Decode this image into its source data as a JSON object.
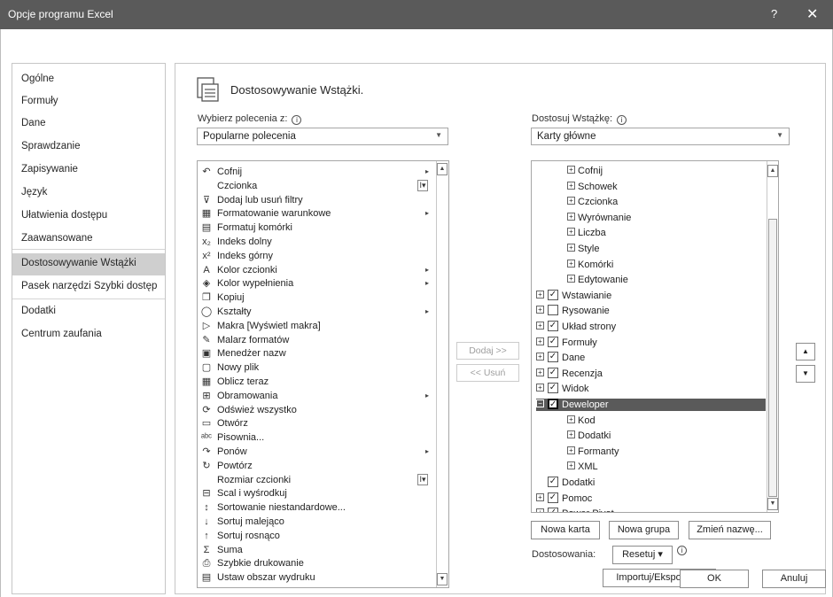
{
  "window": {
    "title": "Opcje programu Excel",
    "help": "?",
    "close": "✕"
  },
  "nav": [
    {
      "label": "Ogólne",
      "selected": false
    },
    {
      "label": "Formuły",
      "selected": false
    },
    {
      "label": "Dane",
      "selected": false
    },
    {
      "label": "Sprawdzanie",
      "selected": false
    },
    {
      "label": "Zapisywanie",
      "selected": false
    },
    {
      "label": "Język",
      "selected": false
    },
    {
      "label": "Ułatwienia dostępu",
      "selected": false
    },
    {
      "label": "Zaawansowane",
      "selected": false
    },
    {
      "label": "Dostosowywanie Wstążki",
      "selected": true
    },
    {
      "label": "Pasek narzędzi Szybki dostęp",
      "selected": false
    },
    {
      "label": "Dodatki",
      "selected": false
    },
    {
      "label": "Centrum zaufania",
      "selected": false
    }
  ],
  "header": {
    "title": "Dostosowywanie Wstążki."
  },
  "left": {
    "choose_label": "Wybierz polecenia z:",
    "choose_value": "Popularne polecenia",
    "commands": [
      {
        "icon": "↶",
        "label": "Cofnij",
        "sub": "▸"
      },
      {
        "icon": "",
        "label": "Czcionka",
        "subbox": "I▾"
      },
      {
        "icon": "⊽",
        "label": "Dodaj lub usuń filtry",
        "sub": ""
      },
      {
        "icon": "▦",
        "label": "Formatowanie warunkowe",
        "sub": "▸"
      },
      {
        "icon": "▤",
        "label": "Formatuj komórki",
        "sub": ""
      },
      {
        "icon": "x₂",
        "label": "Indeks dolny",
        "sub": ""
      },
      {
        "icon": "x²",
        "label": "Indeks górny",
        "sub": ""
      },
      {
        "icon": "A",
        "label": "Kolor czcionki",
        "sub": "▸"
      },
      {
        "icon": "◈",
        "label": "Kolor wypełnienia",
        "sub": "▸"
      },
      {
        "icon": "❐",
        "label": "Kopiuj",
        "sub": ""
      },
      {
        "icon": "◯",
        "label": "Kształty",
        "sub": "▸"
      },
      {
        "icon": "▷",
        "label": "Makra [Wyświetl makra]",
        "sub": ""
      },
      {
        "icon": "✎",
        "label": "Malarz formatów",
        "sub": ""
      },
      {
        "icon": "▣",
        "label": "Menedżer nazw",
        "sub": ""
      },
      {
        "icon": "▢",
        "label": "Nowy plik",
        "sub": ""
      },
      {
        "icon": "▦",
        "label": "Oblicz teraz",
        "sub": ""
      },
      {
        "icon": "⊞",
        "label": "Obramowania",
        "sub": "▸"
      },
      {
        "icon": "⟳",
        "label": "Odśwież wszystko",
        "sub": ""
      },
      {
        "icon": "▭",
        "label": "Otwórz",
        "sub": ""
      },
      {
        "icon": "ᵃᵇᶜ",
        "label": "Pisownia...",
        "sub": ""
      },
      {
        "icon": "↷",
        "label": "Ponów",
        "sub": "▸"
      },
      {
        "icon": "↻",
        "label": "Powtórz",
        "sub": ""
      },
      {
        "icon": "",
        "label": "Rozmiar czcionki",
        "subbox": "I▾"
      },
      {
        "icon": "⊟",
        "label": "Scal i wyśrodkuj",
        "sub": ""
      },
      {
        "icon": "↕",
        "label": "Sortowanie niestandardowe...",
        "sub": ""
      },
      {
        "icon": "↓",
        "label": "Sortuj malejąco",
        "sub": ""
      },
      {
        "icon": "↑",
        "label": "Sortuj rosnąco",
        "sub": ""
      },
      {
        "icon": "Σ",
        "label": "Suma",
        "sub": ""
      },
      {
        "icon": "⎙",
        "label": "Szybkie drukowanie",
        "sub": ""
      },
      {
        "icon": "▤",
        "label": "Ustaw obszar wydruku",
        "sub": ""
      }
    ]
  },
  "middle": {
    "add": "Dodaj >>",
    "remove": "<< Usuń"
  },
  "right": {
    "customize_label": "Dostosuj Wstążkę:",
    "customize_value": "Karty główne",
    "tree": [
      {
        "level": 2,
        "expander": "⊞",
        "check": null,
        "label": "Cofnij"
      },
      {
        "level": 2,
        "expander": "⊞",
        "check": null,
        "label": "Schowek"
      },
      {
        "level": 2,
        "expander": "⊞",
        "check": null,
        "label": "Czcionka"
      },
      {
        "level": 2,
        "expander": "⊞",
        "check": null,
        "label": "Wyrównanie"
      },
      {
        "level": 2,
        "expander": "⊞",
        "check": null,
        "label": "Liczba"
      },
      {
        "level": 2,
        "expander": "⊞",
        "check": null,
        "label": "Style"
      },
      {
        "level": 2,
        "expander": "⊞",
        "check": null,
        "label": "Komórki"
      },
      {
        "level": 2,
        "expander": "⊞",
        "check": null,
        "label": "Edytowanie"
      },
      {
        "level": 1,
        "expander": "⊞",
        "check": true,
        "label": "Wstawianie"
      },
      {
        "level": 1,
        "expander": "⊞",
        "check": false,
        "label": "Rysowanie"
      },
      {
        "level": 1,
        "expander": "⊞",
        "check": true,
        "label": "Układ strony"
      },
      {
        "level": 1,
        "expander": "⊞",
        "check": true,
        "label": "Formuły"
      },
      {
        "level": 1,
        "expander": "⊞",
        "check": true,
        "label": "Dane"
      },
      {
        "level": 1,
        "expander": "⊞",
        "check": true,
        "label": "Recenzja"
      },
      {
        "level": 1,
        "expander": "⊞",
        "check": true,
        "label": "Widok"
      },
      {
        "level": 1,
        "expander": "⊟",
        "check": true,
        "label": "Deweloper",
        "selected": true
      },
      {
        "level": 2,
        "expander": "⊞",
        "check": null,
        "label": "Kod"
      },
      {
        "level": 2,
        "expander": "⊞",
        "check": null,
        "label": "Dodatki"
      },
      {
        "level": 2,
        "expander": "⊞",
        "check": null,
        "label": "Formanty"
      },
      {
        "level": 2,
        "expander": "⊞",
        "check": null,
        "label": "XML"
      },
      {
        "level": 1,
        "expander": "",
        "check": true,
        "label": "Dodatki"
      },
      {
        "level": 1,
        "expander": "⊞",
        "check": true,
        "label": "Pomoc"
      },
      {
        "level": 1,
        "expander": "⊞",
        "check": true,
        "label": "Power Pivot"
      }
    ],
    "new_tab": "Nowa karta",
    "new_group": "Nowa grupa",
    "rename": "Zmień nazwę...",
    "customizations_label": "Dostosowania:",
    "reset": "Resetuj ▾",
    "import_export": "Importuj/Eksportuj ▾",
    "info": "i"
  },
  "footer": {
    "ok": "OK",
    "cancel": "Anuluj"
  }
}
